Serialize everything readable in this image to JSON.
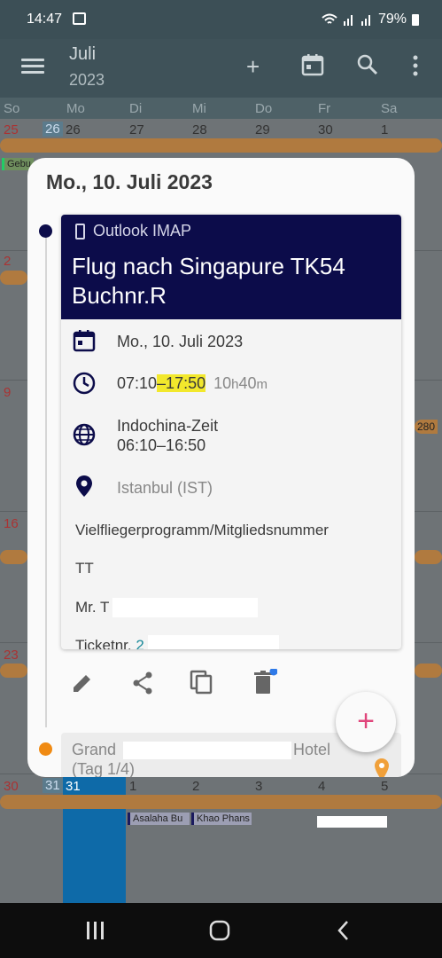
{
  "status": {
    "time": "14:47",
    "battery": "79%"
  },
  "appbar": {
    "month": "Juli",
    "year": "2023"
  },
  "weekdays": [
    "So",
    "Mo",
    "Di",
    "Mi",
    "Do",
    "Fr",
    "Sa"
  ],
  "grid": {
    "row1": [
      "25",
      "26",
      "26",
      "27",
      "28",
      "29",
      "30",
      "1"
    ],
    "row1_chip": "Gebu",
    "row2_start": "2",
    "row3_start": "9",
    "row3_badge": "280",
    "row4_start": "16",
    "row5_start": "23",
    "row6": [
      "30",
      "31",
      "31",
      "1",
      "2",
      "3",
      "4",
      "5"
    ],
    "row6_chips": [
      "Asalaha Bu",
      "Khao Phans"
    ]
  },
  "modal": {
    "date": "Mo., 10. Juli 2023",
    "source": "Outlook IMAP",
    "title": "Flug nach Singapure TK54 Buchnr.R",
    "event_date": "Mo., 10. Juli 2023",
    "time_start": "07:10",
    "time_end": "–17:50",
    "duration_h": "10",
    "duration_h_unit": "h",
    "duration_m": "40",
    "duration_m_unit": "m",
    "tz_name": "Indochina-Zeit",
    "tz_time": "06:10–16:50",
    "location": "Istanbul (IST)",
    "desc1": "Vielfliegerprogramm/Mitgliedsnummer",
    "desc2": "TT",
    "desc3": "Mr. T",
    "desc4": "Ticketnr.",
    "desc4_num": "2",
    "next_title_a": "Grand",
    "next_title_b": "Hotel",
    "next_sub": "(Tag 1/4)"
  },
  "colors": {
    "header": "#0c0c4a",
    "accent": "#e0457b",
    "highlight": "#f2e82c",
    "orange": "#f08a12"
  }
}
